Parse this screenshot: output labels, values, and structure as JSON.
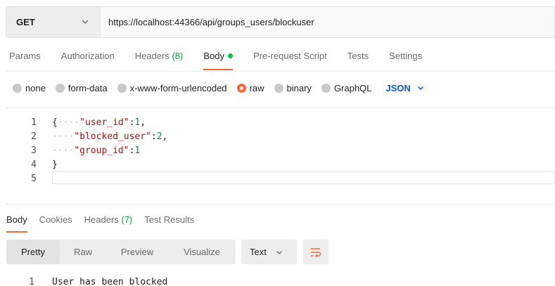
{
  "request": {
    "method": "GET",
    "url": "https://localhost:44366/api/groups_users/blockuser"
  },
  "request_tabs": [
    {
      "label": "Params",
      "count": ""
    },
    {
      "label": "Authorization",
      "count": ""
    },
    {
      "label": "Headers",
      "count": "(8)"
    },
    {
      "label": "Body",
      "count": "",
      "active": true
    },
    {
      "label": "Pre-request Script",
      "count": ""
    },
    {
      "label": "Tests",
      "count": ""
    },
    {
      "label": "Settings",
      "count": ""
    }
  ],
  "body_types": [
    {
      "label": "none",
      "selected": false
    },
    {
      "label": "form-data",
      "selected": false
    },
    {
      "label": "x-www-form-urlencoded",
      "selected": false
    },
    {
      "label": "raw",
      "selected": true
    },
    {
      "label": "binary",
      "selected": false
    },
    {
      "label": "GraphQL",
      "selected": false
    }
  ],
  "format": "JSON",
  "editor": {
    "line_numbers": [
      "1",
      "2",
      "3",
      "4",
      "5"
    ],
    "open_brace": "{",
    "close_brace": "}",
    "fields": [
      {
        "key": "\"user_id\"",
        "colon": ":",
        "value": "1",
        "sep": ","
      },
      {
        "key": "\"blocked_user\"",
        "colon": ":",
        "value": "2",
        "sep": ","
      },
      {
        "key": "\"group_id\"",
        "colon": ":",
        "value": "1",
        "sep": ""
      }
    ],
    "indent_dots": "····"
  },
  "response_tabs": [
    {
      "label": "Body",
      "count": "",
      "active": true
    },
    {
      "label": "Cookies",
      "count": ""
    },
    {
      "label": "Headers",
      "count": "(7)"
    },
    {
      "label": "Test Results",
      "count": ""
    }
  ],
  "view_modes": [
    "Pretty",
    "Raw",
    "Preview",
    "Visualize"
  ],
  "active_view": "Pretty",
  "text_format": "Text",
  "response": {
    "line_number": "1",
    "text": "User has been blocked"
  },
  "colors": {
    "accent": "#f26b3a",
    "json_blue": "#0b57d0",
    "count_green": "#0d9e3e",
    "key_red": "#a31515"
  },
  "icons": [
    "chevron-down-icon",
    "wrap-lines-icon"
  ]
}
